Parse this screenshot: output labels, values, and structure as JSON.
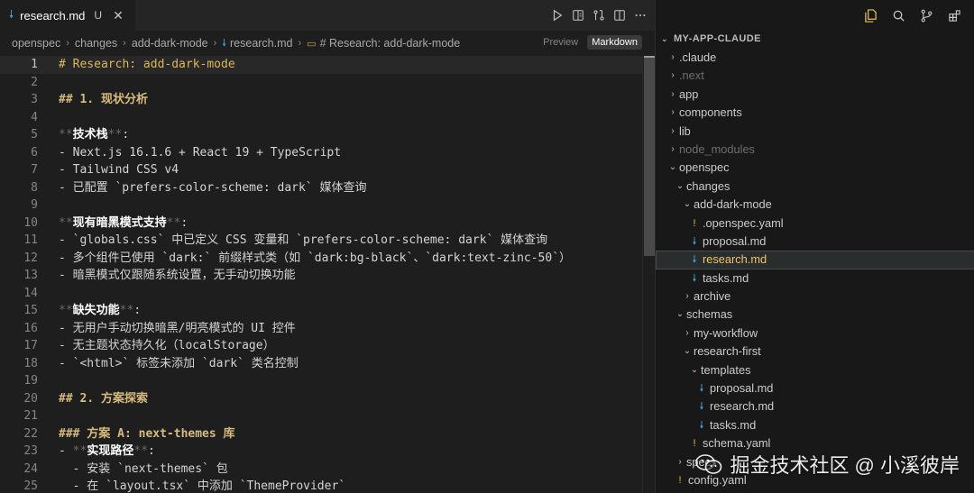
{
  "tab": {
    "title": "research.md",
    "state": "U"
  },
  "breadcrumb": [
    "openspec",
    "changes",
    "add-dark-mode",
    "research.md",
    "# Research: add-dark-mode"
  ],
  "mode": {
    "preview": "Preview",
    "markdown": "Markdown"
  },
  "editor_lines": [
    [
      {
        "t": "# Research: add-dark-mode",
        "c": "h1"
      }
    ],
    [],
    [
      {
        "t": "## 1. 现状分析",
        "c": "h"
      }
    ],
    [],
    [
      {
        "t": "**",
        "c": "dim"
      },
      {
        "t": "技术栈",
        "c": "bold"
      },
      {
        "t": "**",
        "c": "dim"
      },
      {
        "t": ":"
      }
    ],
    [
      {
        "t": "- Next.js 16.1.6 + React 19 + TypeScript"
      }
    ],
    [
      {
        "t": "- Tailwind CSS v4"
      }
    ],
    [
      {
        "t": "- 已配置 `prefers-color-scheme: dark` 媒体查询"
      }
    ],
    [],
    [
      {
        "t": "**",
        "c": "dim"
      },
      {
        "t": "现有暗黑模式支持",
        "c": "bold"
      },
      {
        "t": "**",
        "c": "dim"
      },
      {
        "t": ":"
      }
    ],
    [
      {
        "t": "- `globals.css` 中已定义 CSS 变量和 `prefers-color-scheme: dark` 媒体查询"
      }
    ],
    [
      {
        "t": "- 多个组件已使用 `dark:` 前缀样式类（如 `dark:bg-black`、`dark:text-zinc-50`）"
      }
    ],
    [
      {
        "t": "- 暗黑模式仅跟随系统设置，无手动切换功能"
      }
    ],
    [],
    [
      {
        "t": "**",
        "c": "dim"
      },
      {
        "t": "缺失功能",
        "c": "bold"
      },
      {
        "t": "**",
        "c": "dim"
      },
      {
        "t": ":"
      }
    ],
    [
      {
        "t": "- 无用户手动切换暗黑/明亮模式的 UI 控件"
      }
    ],
    [
      {
        "t": "- 无主题状态持久化（localStorage）"
      }
    ],
    [
      {
        "t": "- `<html>` 标签未添加 `dark` 类名控制"
      }
    ],
    [],
    [
      {
        "t": "## 2. 方案探索",
        "c": "h"
      }
    ],
    [],
    [
      {
        "t": "### 方案 A: next-themes 库",
        "c": "h"
      }
    ],
    [
      {
        "t": "- "
      },
      {
        "t": "**",
        "c": "dim"
      },
      {
        "t": "实现路径",
        "c": "bold"
      },
      {
        "t": "**",
        "c": "dim"
      },
      {
        "t": ":"
      }
    ],
    [
      {
        "t": "  - 安装 `next-themes` 包"
      }
    ],
    [
      {
        "t": "  - 在 `layout.tsx` 中添加 `ThemeProvider`"
      }
    ]
  ],
  "explorer": {
    "title": "MY-APP-CLAUDE",
    "nodes": [
      {
        "label": ".claude",
        "depth": 0,
        "kind": "folder",
        "open": false
      },
      {
        "label": ".next",
        "depth": 0,
        "kind": "folder",
        "open": false,
        "muted": true
      },
      {
        "label": "app",
        "depth": 0,
        "kind": "folder",
        "open": false
      },
      {
        "label": "components",
        "depth": 0,
        "kind": "folder",
        "open": false
      },
      {
        "label": "lib",
        "depth": 0,
        "kind": "folder",
        "open": false
      },
      {
        "label": "node_modules",
        "depth": 0,
        "kind": "folder",
        "open": false,
        "muted": true
      },
      {
        "label": "openspec",
        "depth": 0,
        "kind": "folder",
        "open": true
      },
      {
        "label": "changes",
        "depth": 1,
        "kind": "folder",
        "open": true
      },
      {
        "label": "add-dark-mode",
        "depth": 2,
        "kind": "folder",
        "open": true
      },
      {
        "label": ".openspec.yaml",
        "depth": 3,
        "kind": "yaml"
      },
      {
        "label": "proposal.md",
        "depth": 3,
        "kind": "md"
      },
      {
        "label": "research.md",
        "depth": 3,
        "kind": "md",
        "selected": true
      },
      {
        "label": "tasks.md",
        "depth": 3,
        "kind": "md"
      },
      {
        "label": "archive",
        "depth": 2,
        "kind": "folder",
        "open": false
      },
      {
        "label": "schemas",
        "depth": 1,
        "kind": "folder",
        "open": true
      },
      {
        "label": "my-workflow",
        "depth": 2,
        "kind": "folder",
        "open": false
      },
      {
        "label": "research-first",
        "depth": 2,
        "kind": "folder",
        "open": true
      },
      {
        "label": "templates",
        "depth": 3,
        "kind": "folder",
        "open": true
      },
      {
        "label": "proposal.md",
        "depth": 4,
        "kind": "md"
      },
      {
        "label": "research.md",
        "depth": 4,
        "kind": "md"
      },
      {
        "label": "tasks.md",
        "depth": 4,
        "kind": "md"
      },
      {
        "label": "schema.yaml",
        "depth": 3,
        "kind": "yaml"
      },
      {
        "label": "specs",
        "depth": 1,
        "kind": "folder",
        "open": false
      },
      {
        "label": "config.yaml",
        "depth": 1,
        "kind": "yaml"
      }
    ]
  },
  "watermark": "掘金技术社区 @ 小溪彼岸",
  "icons": {
    "md": "markdown-file-icon",
    "yaml": "yaml-file-icon",
    "explorer": "files-icon",
    "search": "search-icon",
    "scm": "source-control-icon",
    "extensions": "extensions-icon"
  },
  "colors": {
    "accent": "#e8c35a",
    "md_icon": "#4aa3df",
    "yaml_icon": "#e0c045",
    "heading": "#d7ba7d"
  }
}
